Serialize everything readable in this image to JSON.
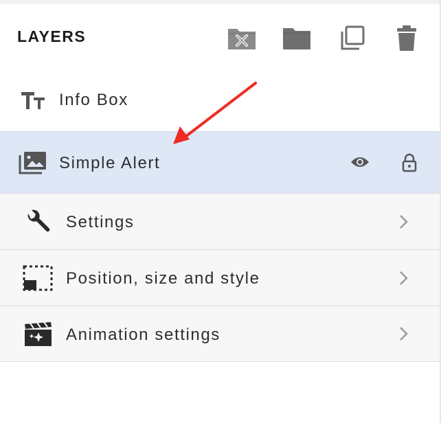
{
  "panel": {
    "title": "LAYERS",
    "toolbar": [
      {
        "name": "ungroup-folder-icon"
      },
      {
        "name": "folder-icon"
      },
      {
        "name": "duplicate-icon"
      },
      {
        "name": "trash-icon"
      }
    ]
  },
  "layers": [
    {
      "label": "Info Box",
      "icon": "text-layer-icon",
      "selected": false
    },
    {
      "label": "Simple Alert",
      "icon": "image-layer-icon",
      "selected": true,
      "visible_icon": "eye-icon",
      "lock_icon": "unlock-icon"
    }
  ],
  "properties": [
    {
      "label": "Settings",
      "icon": "wrench-icon"
    },
    {
      "label": "Position, size and style",
      "icon": "position-icon"
    },
    {
      "label": "Animation settings",
      "icon": "animation-icon"
    }
  ],
  "colors": {
    "selected_row": "#dde7f6",
    "property_row": "#f7f7f7",
    "annotation_arrow": "#ee2b22",
    "toolbar_icon": "#6f6f6f"
  }
}
